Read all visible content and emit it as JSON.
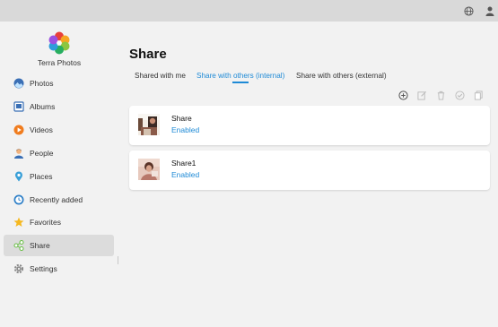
{
  "app": {
    "title": "Terra Photos"
  },
  "topbar": {
    "icons": [
      "globe-icon",
      "user-icon"
    ]
  },
  "sidebar": {
    "items": [
      {
        "label": "Photos",
        "icon": "photos-icon"
      },
      {
        "label": "Albums",
        "icon": "albums-icon"
      },
      {
        "label": "Videos",
        "icon": "videos-icon"
      },
      {
        "label": "People",
        "icon": "people-icon"
      },
      {
        "label": "Places",
        "icon": "places-icon"
      },
      {
        "label": "Recently added",
        "icon": "recently-added-icon"
      },
      {
        "label": "Favorites",
        "icon": "favorites-icon"
      },
      {
        "label": "Share",
        "icon": "share-icon",
        "active": true
      },
      {
        "label": "Settings",
        "icon": "settings-icon"
      }
    ]
  },
  "main": {
    "title": "Share",
    "tabs": [
      {
        "label": "Shared with me"
      },
      {
        "label": "Share with others (internal)",
        "active": true
      },
      {
        "label": "Share with others (external)"
      }
    ],
    "toolbar": [
      "add-icon",
      "edit-icon",
      "delete-icon",
      "select-icon",
      "copy-icon"
    ],
    "shares": [
      {
        "name": "Share",
        "status": "Enabled"
      },
      {
        "name": "Share1",
        "status": "Enabled"
      }
    ]
  },
  "colors": {
    "accent": "#1e8ad6",
    "active_nav": "#dcdcdc",
    "topbar": "#d9d9d9",
    "background": "#f2f2f2"
  }
}
